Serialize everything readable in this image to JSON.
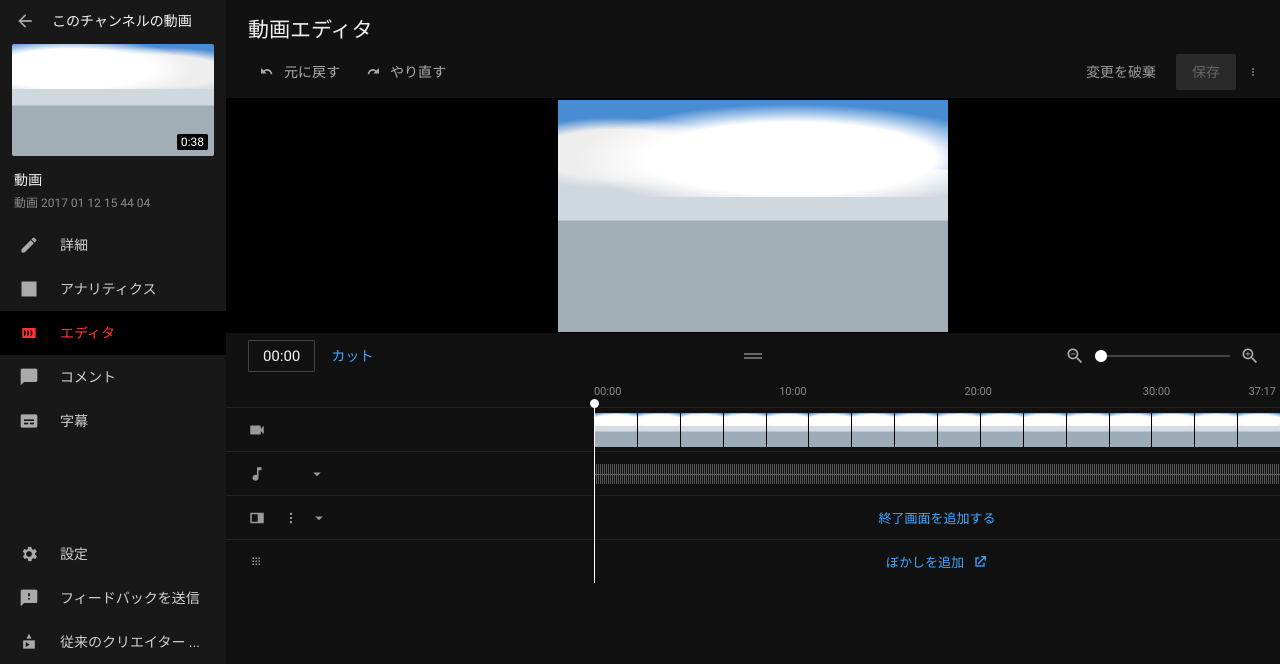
{
  "sidebar": {
    "back_label": "このチャンネルの動画",
    "thumb_duration": "0:38",
    "meta_title": "動画",
    "meta_subtitle": "動画 2017 01 12 15 44 04",
    "nav": [
      {
        "icon": "edit",
        "label": "詳細"
      },
      {
        "icon": "analytics",
        "label": "アナリティクス"
      },
      {
        "icon": "editor",
        "label": "エディタ",
        "active": true
      },
      {
        "icon": "comment",
        "label": "コメント"
      },
      {
        "icon": "subtitles",
        "label": "字幕"
      }
    ],
    "footer": [
      {
        "icon": "settings",
        "label": "設定"
      },
      {
        "icon": "feedback",
        "label": "フィードバックを送信"
      },
      {
        "icon": "legacy",
        "label": "従来のクリエイター ..."
      }
    ]
  },
  "header": {
    "title": "動画エディタ",
    "undo": "元に戻す",
    "redo": "やり直す",
    "discard": "変更を破棄",
    "save": "保存"
  },
  "timeline": {
    "current_time": "00:00",
    "cut": "カット",
    "ruler": [
      "00:00",
      "10:00",
      "20:00",
      "30:00",
      "37:17"
    ],
    "end_screen_action": "終了画面を追加する",
    "blur_action": "ぼかしを追加"
  }
}
